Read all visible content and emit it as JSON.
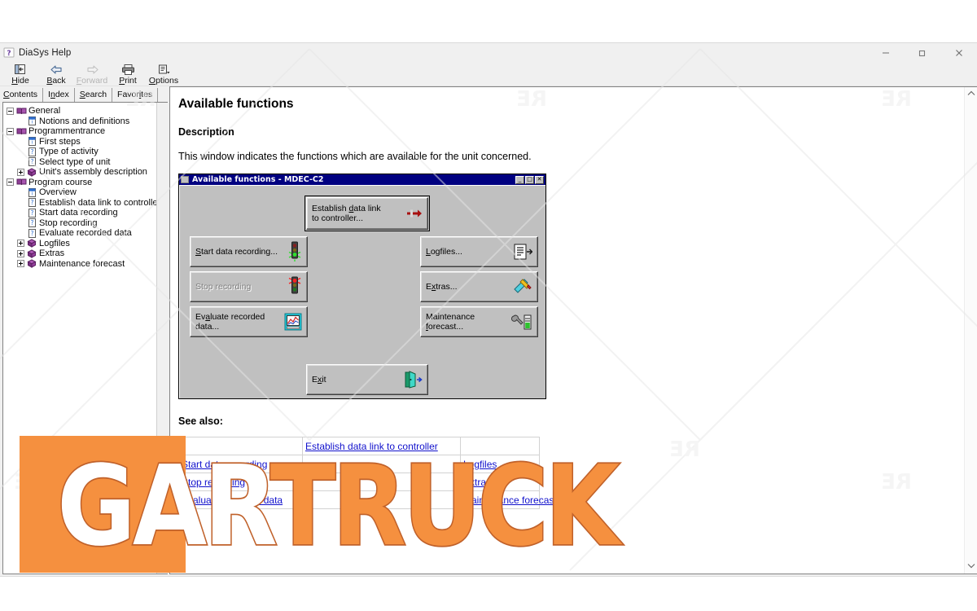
{
  "window": {
    "title": "DiaSys Help",
    "app_icon": "help-question-icon",
    "controls": [
      {
        "name": "minimize",
        "glyph": "minimize-icon"
      },
      {
        "name": "restore",
        "glyph": "restore-icon"
      },
      {
        "name": "close",
        "glyph": "close-icon"
      }
    ]
  },
  "toolbar": {
    "items": [
      {
        "label": "Hide",
        "accel": "H",
        "icon": "hide-pane-icon",
        "disabled": false
      },
      {
        "label": "Back",
        "accel": "B",
        "icon": "arrow-left-icon",
        "disabled": false
      },
      {
        "label": "Forward",
        "accel": "F",
        "icon": "arrow-right-icon",
        "disabled": true
      },
      {
        "label": "Print",
        "accel": "P",
        "icon": "printer-icon",
        "disabled": false
      },
      {
        "label": "Options",
        "accel": "O",
        "icon": "options-icon",
        "disabled": false
      }
    ]
  },
  "nav": {
    "tabs": [
      {
        "label": "Contents",
        "accel": "C",
        "selected": true
      },
      {
        "label": "Index",
        "accel": "n",
        "selected": false
      },
      {
        "label": "Search",
        "accel": "S",
        "selected": false
      },
      {
        "label": "Favorites",
        "accel": "i",
        "selected": false
      }
    ],
    "tree": [
      {
        "label": "General",
        "indent": 0,
        "icon": "book-icon",
        "expander": "minus"
      },
      {
        "label": "Notions and definitions",
        "indent": 1,
        "icon": "topic-info-icon",
        "expander": "none"
      },
      {
        "label": "Programmentrance",
        "indent": 0,
        "icon": "book-icon",
        "expander": "minus"
      },
      {
        "label": "First steps",
        "indent": 1,
        "icon": "topic-info-icon",
        "expander": "none"
      },
      {
        "label": "Type of activity",
        "indent": 1,
        "icon": "topic-help-icon",
        "expander": "none"
      },
      {
        "label": "Select type of unit",
        "indent": 1,
        "icon": "topic-help-icon",
        "expander": "none"
      },
      {
        "label": "Unit's assembly description",
        "indent": 1,
        "icon": "node-cube-icon",
        "expander": "plus"
      },
      {
        "label": "Program course",
        "indent": 0,
        "icon": "book-icon",
        "expander": "minus"
      },
      {
        "label": "Overview",
        "indent": 1,
        "icon": "topic-info-icon",
        "expander": "none"
      },
      {
        "label": "Establish data link to controller",
        "indent": 1,
        "icon": "topic-help-icon",
        "expander": "none"
      },
      {
        "label": "Start data recording",
        "indent": 1,
        "icon": "topic-help-icon",
        "expander": "none"
      },
      {
        "label": "Stop recording",
        "indent": 1,
        "icon": "topic-help-icon",
        "expander": "none"
      },
      {
        "label": "Evaluate recorded data",
        "indent": 1,
        "icon": "topic-help-icon",
        "expander": "none"
      },
      {
        "label": "Logfiles",
        "indent": 1,
        "icon": "node-cube-icon",
        "expander": "plus"
      },
      {
        "label": "Extras",
        "indent": 1,
        "icon": "node-cube-icon",
        "expander": "plus"
      },
      {
        "label": "Maintenance forecast",
        "indent": 1,
        "icon": "node-cube-icon",
        "expander": "plus"
      }
    ]
  },
  "doc": {
    "title": "Available functions",
    "description_heading": "Description",
    "description_body": "This window indicates the functions which are available for the unit concerned.",
    "see_also_heading": "See also:",
    "dialog": {
      "title": "Available functions - MDEC-C2",
      "title_icon": "window-icon",
      "caption_buttons": [
        "minimize-icon",
        "maximize-icon",
        "close-icon"
      ],
      "buttons": [
        {
          "label": "Establish data link to controller...",
          "label_line1": "Establish data link",
          "label_line2": "to controller...",
          "icon": "connector-plug-icon",
          "state": "focused"
        },
        {
          "label": "Start data recording...",
          "icon": "traffic-light-green-icon",
          "state": "enabled"
        },
        {
          "label": "Stop recording",
          "icon": "traffic-light-red-icon",
          "state": "disabled"
        },
        {
          "label": "Evaluate recorded data...",
          "icon": "chart-monitor-icon",
          "state": "enabled"
        },
        {
          "label": "Logfiles...",
          "icon": "document-list-icon",
          "state": "enabled"
        },
        {
          "label": "Extras...",
          "icon": "ruler-pencil-icon",
          "state": "enabled"
        },
        {
          "label": "Maintenance forecast...",
          "icon": "wrench-battery-icon",
          "state": "enabled"
        },
        {
          "label": "Exit",
          "icon": "exit-door-icon",
          "state": "enabled"
        }
      ]
    },
    "see_also_rows": [
      [
        {
          "text": "",
          "link": false
        },
        {
          "text": "Establish data link to controller",
          "link": true
        },
        {
          "text": "",
          "link": false
        }
      ],
      [
        {
          "text": "Start data recording",
          "link": true
        },
        {
          "text": "",
          "link": false
        },
        {
          "text": "Logfiles",
          "link": true
        }
      ],
      [
        {
          "text": "Stop recording",
          "link": true
        },
        {
          "text": "",
          "link": false
        },
        {
          "text": "Extras",
          "link": true
        }
      ],
      [
        {
          "text": "Evaluate recorded data",
          "link": true
        },
        {
          "text": "",
          "link": false
        },
        {
          "text": "Maintenance forecast",
          "link": true
        }
      ]
    ]
  },
  "watermark": {
    "segment_white": "GAR",
    "segment_orange": "TRUCK",
    "box_color": "#f5903f",
    "outline_color": "#c0612a"
  },
  "colors": {
    "dialog_titlebar": "#000080",
    "dialog_face": "#c0c0c0",
    "link": "#1111cc",
    "chrome": "#f0f0f0"
  }
}
